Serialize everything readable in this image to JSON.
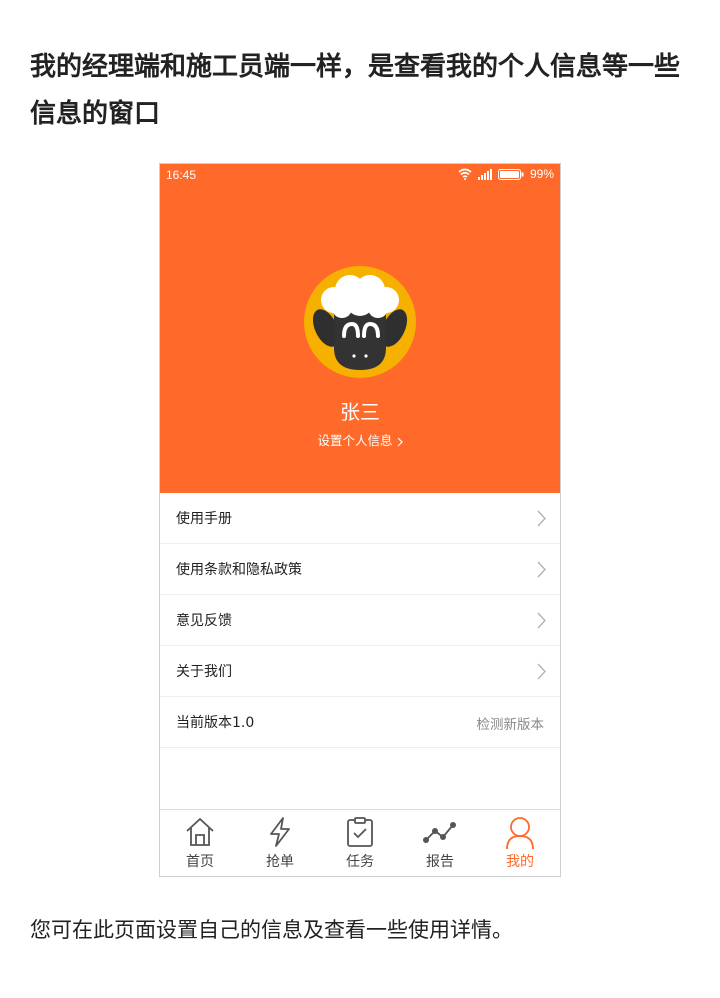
{
  "article": {
    "heading": "我的经理端和施工员端一样，是查看我的个人信息等一些信息的窗口",
    "caption": "您可在此页面设置自己的信息及查看一些使用详情。"
  },
  "status_bar": {
    "time": "16:45",
    "battery": "99%",
    "icons": [
      "wifi-icon",
      "signal-icon",
      "battery-icon"
    ]
  },
  "profile": {
    "name": "张三",
    "settings_link": "设置个人信息",
    "avatar_icon": "sheep-avatar-icon"
  },
  "menu": {
    "items": [
      {
        "label": "使用手册"
      },
      {
        "label": "使用条款和隐私政策"
      },
      {
        "label": "意见反馈"
      },
      {
        "label": "关于我们"
      }
    ],
    "version": {
      "label": "当前版本1.0",
      "action": "检测新版本"
    }
  },
  "tabbar": {
    "tabs": [
      {
        "label": "首页",
        "icon": "home-icon"
      },
      {
        "label": "抢单",
        "icon": "lightning-icon"
      },
      {
        "label": "任务",
        "icon": "clipboard-check-icon"
      },
      {
        "label": "报告",
        "icon": "line-chart-icon"
      },
      {
        "label": "我的",
        "icon": "user-icon",
        "active": true
      }
    ]
  },
  "colors": {
    "accent": "#ff6a2a",
    "avatar_bg": "#f6b000",
    "text": "#222222",
    "muted": "#888888"
  }
}
